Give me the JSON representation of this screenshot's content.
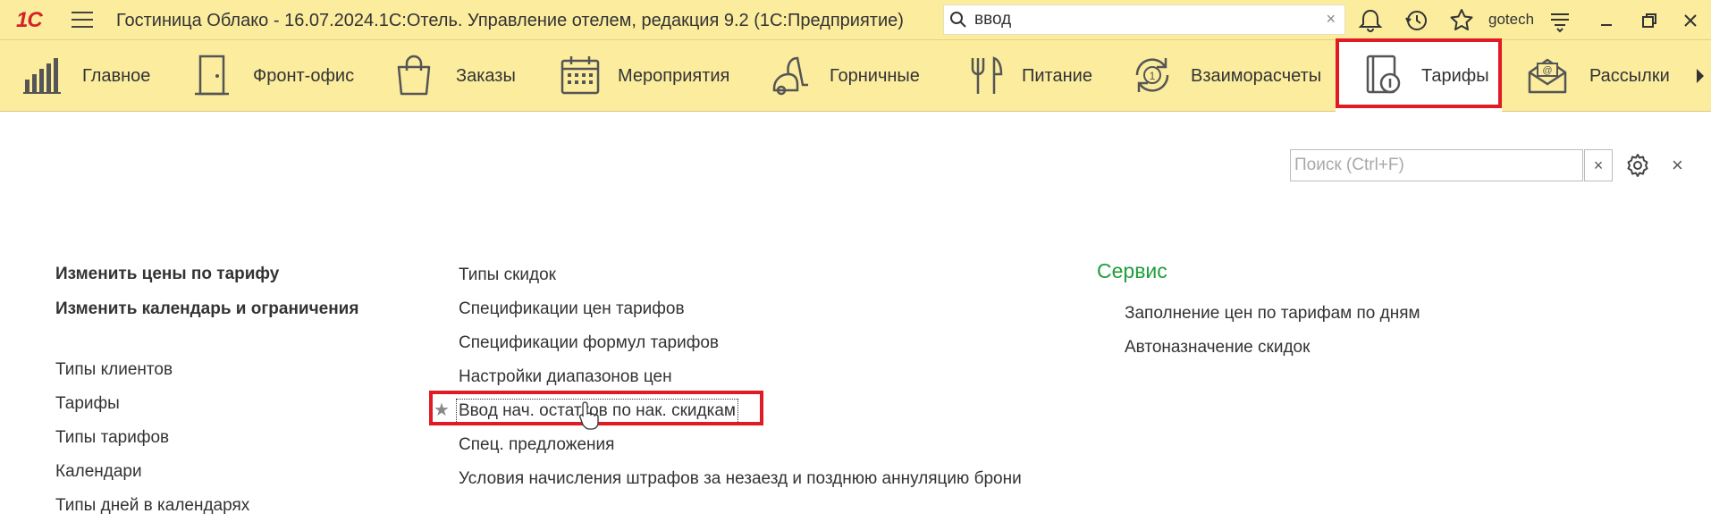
{
  "app": {
    "logo": "1С",
    "title": "Гостиница Облако - 16.07.2024.1С:Отель. Управление отелем, редакция 9.2  (1С:Предприятие)",
    "search_value": "ввод",
    "user": "gotech"
  },
  "sections": [
    {
      "label": "Главное",
      "icon": "chart-bars-icon"
    },
    {
      "label": "Фронт-офис",
      "icon": "door-icon"
    },
    {
      "label": "Заказы",
      "icon": "shopping-bag-icon"
    },
    {
      "label": "Мероприятия",
      "icon": "calendar-icon"
    },
    {
      "label": "Горничные",
      "icon": "vacuum-icon"
    },
    {
      "label": "Питание",
      "icon": "cutlery-icon"
    },
    {
      "label": "Взаиморасчеты",
      "icon": "money-cycle-icon"
    },
    {
      "label": "Тарифы",
      "icon": "tariff-icon",
      "active": true
    },
    {
      "label": "Рассылки",
      "icon": "mail-icon"
    }
  ],
  "content": {
    "search_placeholder": "Поиск (Ctrl+F)",
    "col1_bold": [
      "Изменить цены по тарифу",
      "Изменить календарь и ограничения"
    ],
    "col1": [
      "Типы клиентов",
      "Тарифы",
      "Типы тарифов",
      "Календари",
      "Типы дней в календарях"
    ],
    "col2": [
      "Типы скидок",
      "Спецификации цен тарифов",
      "Спецификации формул тарифов",
      "Настройки диапазонов цен",
      "Ввод нач. остатков по нак. скидкам",
      "Спец. предложения",
      "Условия начисления штрафов за незаезд и позднюю аннуляцию брони"
    ],
    "service_title": "Сервис",
    "col3": [
      "Заполнение цен по тарифам по дням",
      "Автоназначение скидок"
    ]
  },
  "colors": {
    "toolbar_bg": "#fbec9e",
    "highlight": "#e01b24",
    "group_title": "#1e9e3a"
  }
}
